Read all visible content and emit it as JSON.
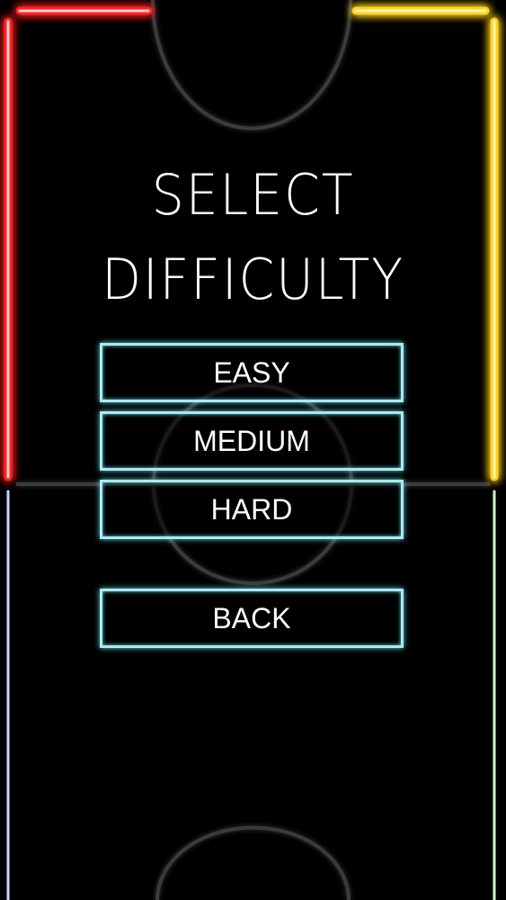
{
  "screen": {
    "title_line_1": "SELECT",
    "title_line_2": "DIFFICULTY"
  },
  "menu": {
    "easy_label": "EASY",
    "medium_label": "MEDIUM",
    "hard_label": "HARD",
    "back_label": "BACK"
  },
  "colors": {
    "background": "#000000",
    "top_left_glow": "#ff1a1a",
    "top_right_glow": "#ffd21a",
    "bottom_left_glow": "#1a4dff",
    "bottom_right_glow": "#1adf1a",
    "button_outline": "#aee7ee",
    "text": "#ffffff"
  }
}
